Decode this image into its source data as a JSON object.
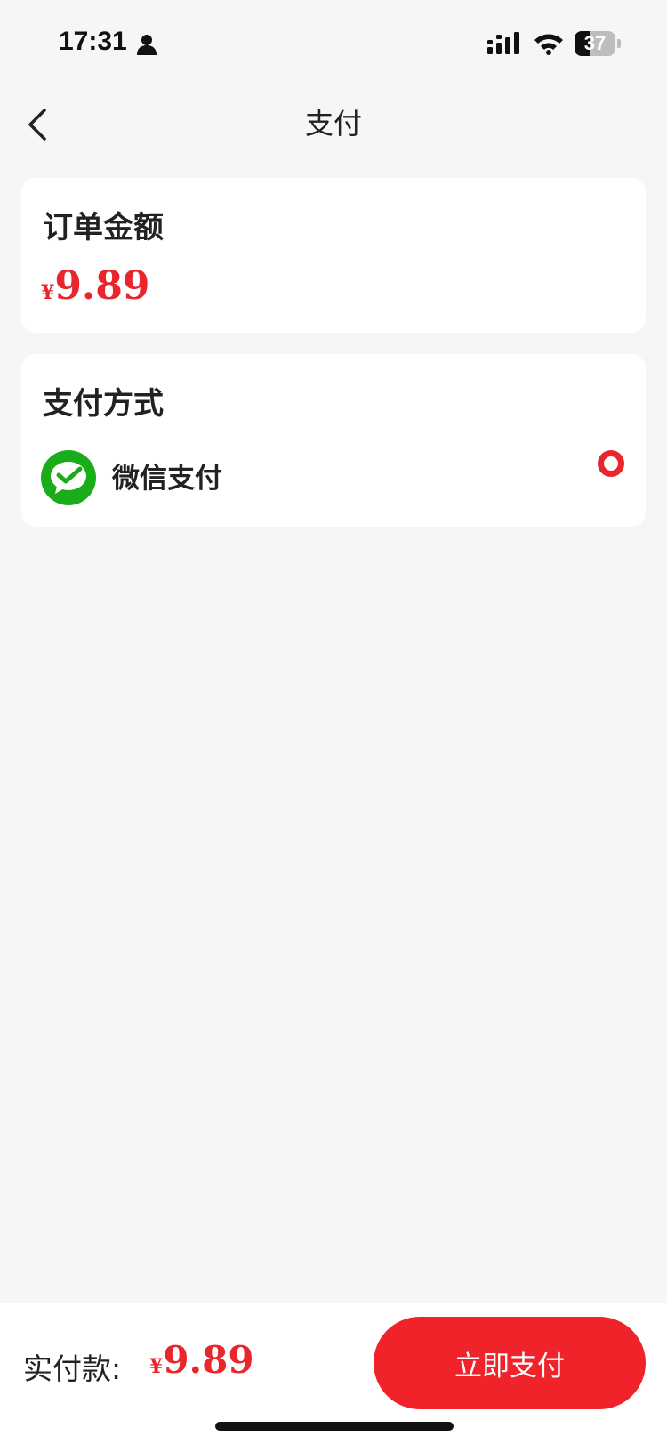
{
  "status_bar": {
    "time": "17:31",
    "battery_level": "37",
    "battery_percent": 37,
    "icons": [
      "person-icon",
      "signal-icon",
      "wifi-icon",
      "battery-icon"
    ]
  },
  "nav": {
    "title": "支付",
    "back_icon": "chevron-left-icon"
  },
  "order": {
    "title": "订单金额",
    "currency": "¥",
    "amount": "9.89"
  },
  "payment_method": {
    "title": "支付方式",
    "options": [
      {
        "label": "微信支付",
        "icon": "wechat-pay-icon",
        "selected": true
      }
    ]
  },
  "bottom_bar": {
    "label": "实付款:",
    "currency": "¥",
    "amount": "9.89",
    "button_label": "立即支付"
  },
  "colors": {
    "accent": "#e8262c",
    "button": "#f0232a",
    "wechat_green": "#1aad19",
    "background": "#f6f6f6",
    "card": "#ffffff"
  }
}
